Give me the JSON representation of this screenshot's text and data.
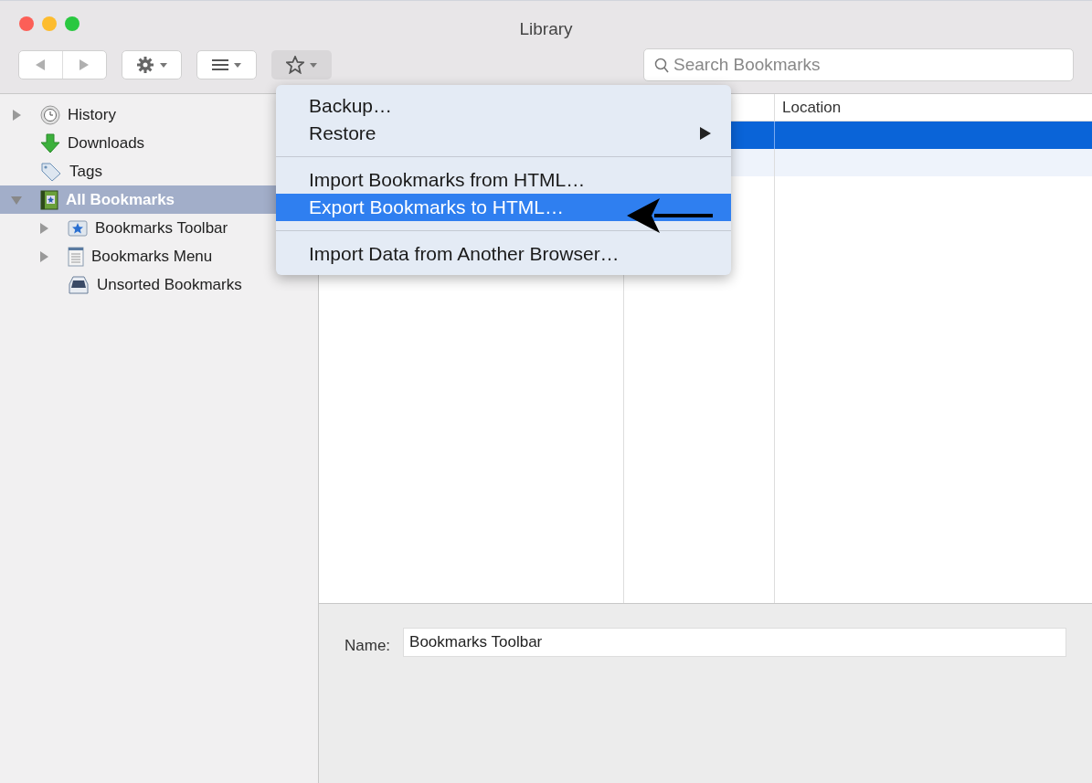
{
  "window": {
    "title": "Library"
  },
  "toolbar": {
    "search": {
      "placeholder": "Search Bookmarks"
    }
  },
  "sidebar": {
    "items": [
      {
        "label": "History",
        "kind": "history",
        "expanded": false,
        "selected": false
      },
      {
        "label": "Downloads",
        "kind": "downloads",
        "selected": false
      },
      {
        "label": "Tags",
        "kind": "tags",
        "selected": false
      },
      {
        "label": "All Bookmarks",
        "kind": "all",
        "expanded": true,
        "selected": true,
        "children": [
          {
            "label": "Bookmarks Toolbar",
            "kind": "toolbar",
            "expanded": false,
            "selected": false
          },
          {
            "label": "Bookmarks Menu",
            "kind": "menu",
            "expanded": false,
            "selected": false
          },
          {
            "label": "Unsorted Bookmarks",
            "kind": "unsorted",
            "selected": false
          }
        ]
      }
    ]
  },
  "table": {
    "columns": [
      "Location"
    ],
    "rows": [
      {
        "selected": true
      },
      {
        "selected": false
      }
    ]
  },
  "details": {
    "name_label": "Name:",
    "name_value": "Bookmarks Toolbar"
  },
  "menu": {
    "items": [
      {
        "kind": "item",
        "label": "Backup…",
        "selected": false,
        "submenu": false
      },
      {
        "kind": "item",
        "label": "Restore",
        "selected": false,
        "submenu": true
      },
      {
        "kind": "separator"
      },
      {
        "kind": "item",
        "label": "Import Bookmarks from HTML…",
        "selected": false,
        "submenu": false
      },
      {
        "kind": "item",
        "label": "Export Bookmarks to HTML…",
        "selected": true,
        "submenu": false
      },
      {
        "kind": "separator"
      },
      {
        "kind": "item",
        "label": "Import Data from Another Browser…",
        "selected": false,
        "submenu": false
      }
    ]
  }
}
